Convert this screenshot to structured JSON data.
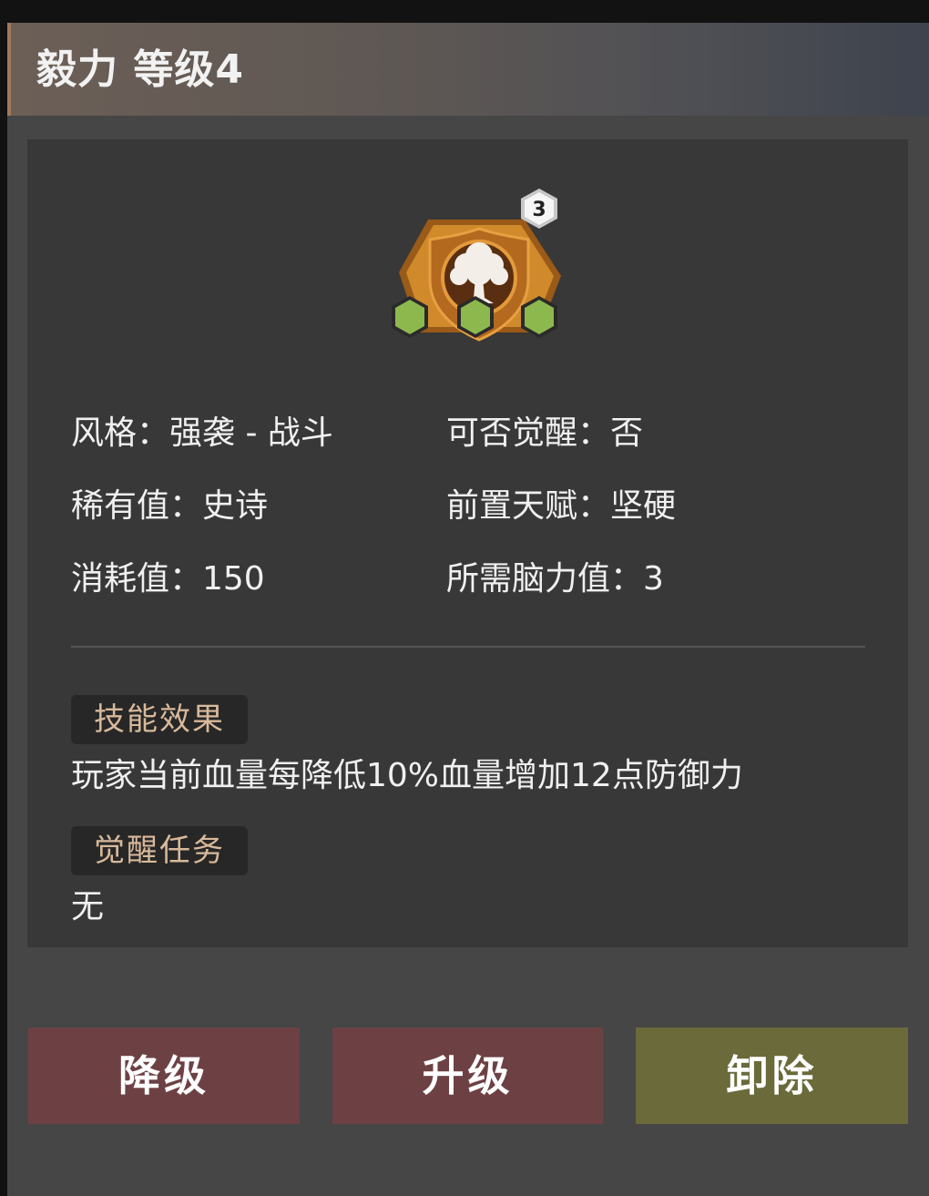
{
  "window": {
    "title": "毅力 等级4"
  },
  "skill": {
    "icon": "tree-emblem-icon",
    "badge_count": "3",
    "slots": [
      "hex-slot-icon",
      "hex-slot-icon",
      "hex-slot-icon"
    ]
  },
  "info": {
    "style": "风格：强袭 - 战斗",
    "awaken": "可否觉醒：否",
    "rarity": "稀有值：史诗",
    "prereq": "前置天赋：坚硬",
    "cost": "消耗值：150",
    "brain": "所需脑力值：3"
  },
  "effect": {
    "tag": "技能效果",
    "text": "玩家当前血量每降低10%血量增加12点防御力"
  },
  "awaken_task": {
    "tag": "觉醒任务",
    "text": "无"
  },
  "buttons": {
    "downgrade": "降级",
    "upgrade": "升级",
    "remove": "卸除"
  },
  "colors": {
    "accent_gold": "#c9872f",
    "slot_green": "#8db84e",
    "button_red": "#6d4144",
    "button_olive": "#6a6a3b",
    "tag_text": "#d8b99a"
  }
}
